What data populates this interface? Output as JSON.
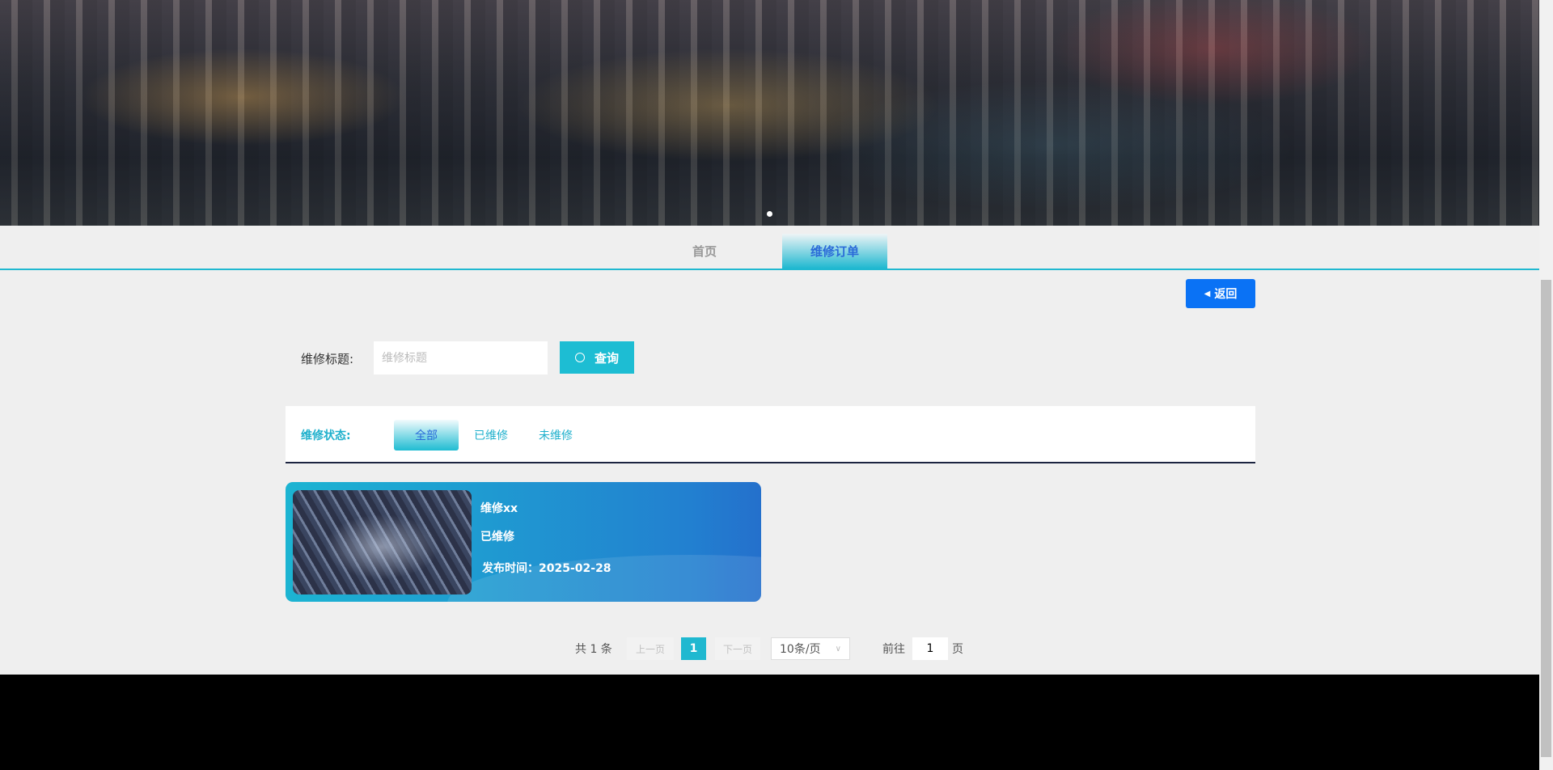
{
  "nav": {
    "tabs": [
      {
        "label": "首页"
      },
      {
        "label": "维修订单"
      }
    ]
  },
  "back_label": "返回",
  "search": {
    "label": "维修标题:",
    "placeholder": "维修标题",
    "button": "查询"
  },
  "filter": {
    "label": "维修状态:",
    "options": [
      "全部",
      "已维修",
      "未维修"
    ],
    "selected": "全部"
  },
  "cards": [
    {
      "title": "维修xx",
      "status": "已维修",
      "time": "发布时间：2025-02-28"
    }
  ],
  "pagination": {
    "total": "共 1 条",
    "prev": "上一页",
    "current": "1",
    "next": "下一页",
    "page_size": "10条/页",
    "goto": "前往",
    "goto_value": "1",
    "unit": "页"
  }
}
